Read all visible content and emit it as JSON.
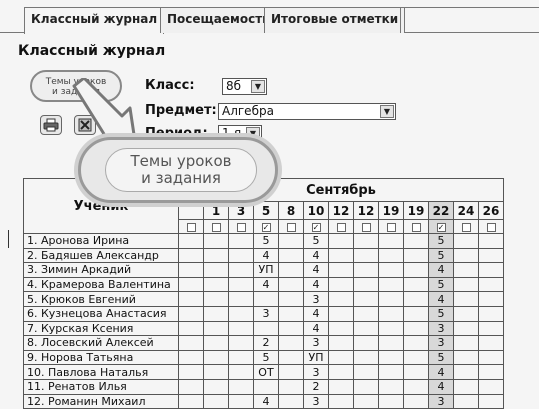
{
  "tabs": [
    {
      "label": "Классный журнал",
      "active": true
    },
    {
      "label": "Посещаемость",
      "active": false
    },
    {
      "label": "Итоговые отметки",
      "active": false
    }
  ],
  "page_title": "Классный журнал",
  "topics_button": {
    "line1": "Темы уроков",
    "line2": "и задания"
  },
  "icons": [
    "printer-icon",
    "export-icon"
  ],
  "form": {
    "class_label": "Класс:",
    "class_value": "8б",
    "subject_label": "Предмет:",
    "subject_value": "Алгебра",
    "period_label": "Период:",
    "period_value": "1-я"
  },
  "callout": {
    "line1": "Темы уроков",
    "line2": "и задания"
  },
  "table": {
    "students_header": "Ученик",
    "month": "Сентябрь",
    "days": [
      "1",
      "3",
      "5",
      "8",
      "10",
      "12",
      "12",
      "19",
      "19",
      "22",
      "24",
      "26"
    ],
    "checked_days": [
      false,
      false,
      false,
      true,
      false,
      true,
      false,
      false,
      false,
      false,
      true,
      false,
      false
    ],
    "shaded_col_index": 10,
    "rows": [
      {
        "name": "1. Аронова Ирина",
        "marks": [
          "",
          "",
          "",
          "5",
          "",
          "5",
          "",
          "",
          "",
          "",
          "5",
          "",
          ""
        ]
      },
      {
        "name": "2. Бадяшев Александр",
        "marks": [
          "",
          "",
          "",
          "4",
          "",
          "4",
          "",
          "",
          "",
          "",
          "5",
          "",
          ""
        ]
      },
      {
        "name": "3. Зимин Аркадий",
        "marks": [
          "",
          "",
          "",
          "УП",
          "",
          "4",
          "",
          "",
          "",
          "",
          "4",
          "",
          ""
        ]
      },
      {
        "name": "4. Крамерова Валентина",
        "marks": [
          "",
          "",
          "",
          "4",
          "",
          "4",
          "",
          "",
          "",
          "",
          "5",
          "",
          ""
        ]
      },
      {
        "name": "5. Крюков Евгений",
        "marks": [
          "",
          "",
          "",
          "",
          "",
          "3",
          "",
          "",
          "",
          "",
          "4",
          "",
          ""
        ]
      },
      {
        "name": "6. Кузнецова Анастасия",
        "marks": [
          "",
          "",
          "",
          "3",
          "",
          "4",
          "",
          "",
          "",
          "",
          "5",
          "",
          ""
        ]
      },
      {
        "name": "7. Курская Ксения",
        "marks": [
          "",
          "",
          "",
          "",
          "",
          "4",
          "",
          "",
          "",
          "",
          "3",
          "",
          ""
        ]
      },
      {
        "name": "8. Лосевский Алексей",
        "marks": [
          "",
          "",
          "",
          "2",
          "",
          "3",
          "",
          "",
          "",
          "",
          "3",
          "",
          ""
        ]
      },
      {
        "name": "9. Норова Татьяна",
        "marks": [
          "",
          "",
          "",
          "5",
          "",
          "УП",
          "",
          "",
          "",
          "",
          "5",
          "",
          ""
        ]
      },
      {
        "name": "10. Павлова Наталья",
        "marks": [
          "",
          "",
          "",
          "ОТ",
          "",
          "3",
          "",
          "",
          "",
          "",
          "4",
          "",
          ""
        ]
      },
      {
        "name": "11. Ренатов Илья",
        "marks": [
          "",
          "",
          "",
          "",
          "",
          "2",
          "",
          "",
          "",
          "",
          "4",
          "",
          ""
        ]
      },
      {
        "name": "12. Романин Михаил",
        "marks": [
          "",
          "",
          "",
          "4",
          "",
          "3",
          "",
          "",
          "",
          "",
          "3",
          "",
          ""
        ]
      }
    ]
  }
}
